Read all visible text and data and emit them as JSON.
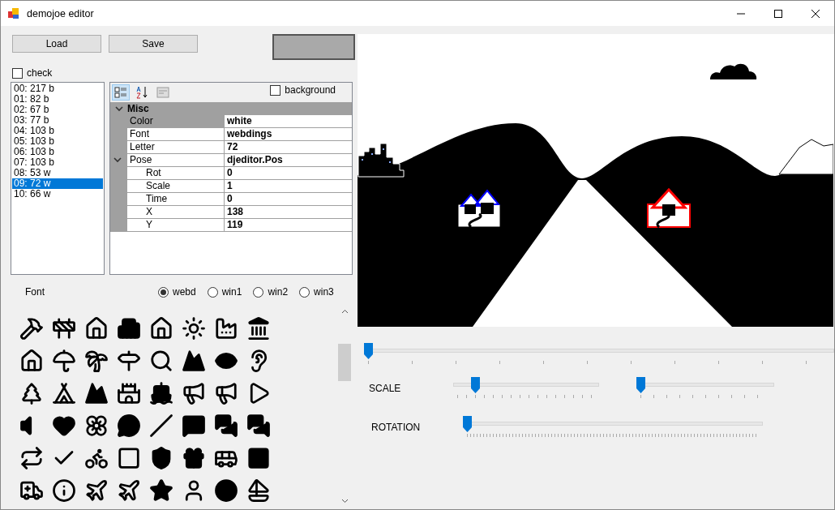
{
  "window": {
    "title": "demojoe editor"
  },
  "buttons": [
    {
      "label": "Load"
    },
    {
      "label": "Save"
    }
  ],
  "check": {
    "label": "check",
    "checked": false
  },
  "background": {
    "label": "background",
    "checked": false
  },
  "items": [
    {
      "label": "00: 217 b",
      "selected": false
    },
    {
      "label": "01: 82 b",
      "selected": false
    },
    {
      "label": "02: 67 b",
      "selected": false
    },
    {
      "label": "03: 77 b",
      "selected": false
    },
    {
      "label": "04: 103 b",
      "selected": false
    },
    {
      "label": "05: 103 b",
      "selected": false
    },
    {
      "label": "06: 103 b",
      "selected": false
    },
    {
      "label": "07: 103 b",
      "selected": false
    },
    {
      "label": "08: 53 w",
      "selected": false
    },
    {
      "label": "09: 72 w",
      "selected": true
    },
    {
      "label": "10: 66 w",
      "selected": false
    }
  ],
  "property_grid": {
    "toolbar": [
      {
        "kind": "categorized",
        "selected": true
      },
      {
        "kind": "alphabetical",
        "selected": false
      },
      {
        "kind": "pages",
        "selected": false
      }
    ],
    "category": {
      "label": "Misc",
      "expanded": true,
      "properties": [
        {
          "name": "Color",
          "value": "white",
          "selected": true
        },
        {
          "name": "Font",
          "value": "webdings",
          "selected": false
        },
        {
          "name": "Letter",
          "value": "72",
          "selected": false
        },
        {
          "name": "Pose",
          "value": "djeditor.Pos",
          "selected": false,
          "expanded": true,
          "children": [
            {
              "name": "Rot",
              "value": "0",
              "selected": false
            },
            {
              "name": "Scale",
              "value": "1",
              "selected": false
            },
            {
              "name": "Time",
              "value": "0",
              "selected": false
            },
            {
              "name": "X",
              "value": "138",
              "selected": false
            },
            {
              "name": "Y",
              "value": "119",
              "selected": false
            }
          ]
        }
      ]
    }
  },
  "font": {
    "label": "Font",
    "options": [
      {
        "label": "webd",
        "selected": true
      },
      {
        "label": "win1",
        "selected": false
      },
      {
        "label": "win2",
        "selected": false
      },
      {
        "label": "win3",
        "selected": false
      }
    ]
  },
  "sliders": [
    {
      "kind": "time",
      "level": 0
    },
    {
      "kind": "scale",
      "label": "SCALE",
      "controls": [
        {
          "level": 0.13
        },
        {
          "level": 0
        }
      ]
    },
    {
      "kind": "rotation",
      "label": "ROTATION",
      "level": 0
    }
  ]
}
